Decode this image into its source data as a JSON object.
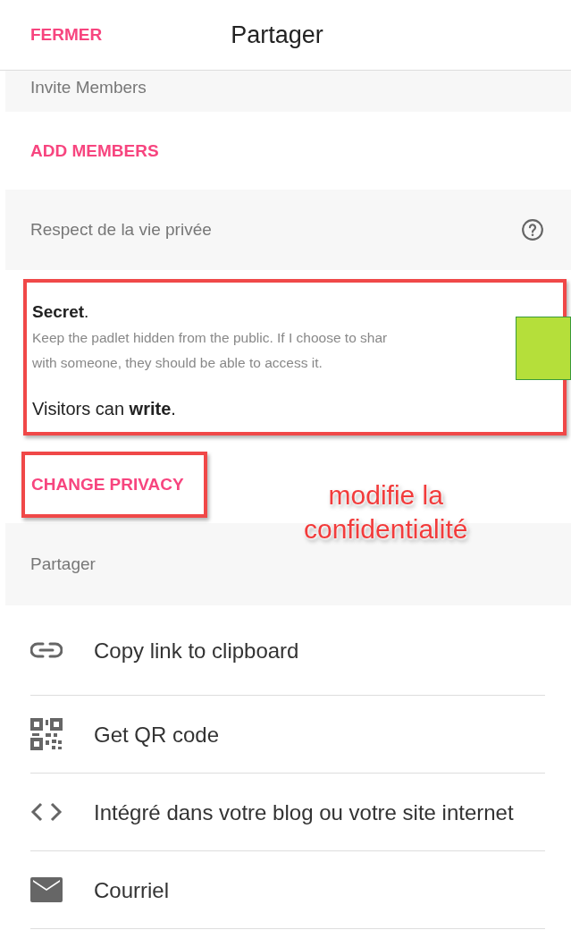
{
  "header": {
    "close_label": "FERMER",
    "title": "Partager"
  },
  "invite": {
    "heading": "Invite Members",
    "action": "ADD MEMBERS"
  },
  "privacy": {
    "heading": "Respect de la vie privée",
    "level": "**Secret**.",
    "description_lines": [
      "Keep the padlet hidden from the public. If I choose to shar",
      "with someone, they should be able to access it."
    ],
    "visitors": "Visitors can **write**.",
    "change_action": "CHANGE PRIVACY"
  },
  "annotation": {
    "lines": [
      "modifie la",
      "confidentialité"
    ]
  },
  "share": {
    "heading": "Partager",
    "items": [
      {
        "kind": "link",
        "label": "Copy link to clipboard"
      },
      {
        "kind": "qr",
        "label": "Get QR code"
      },
      {
        "kind": "embed",
        "label": "Intégré dans votre blog ou votre site internet"
      },
      {
        "kind": "email",
        "label": "Courriel"
      }
    ]
  }
}
